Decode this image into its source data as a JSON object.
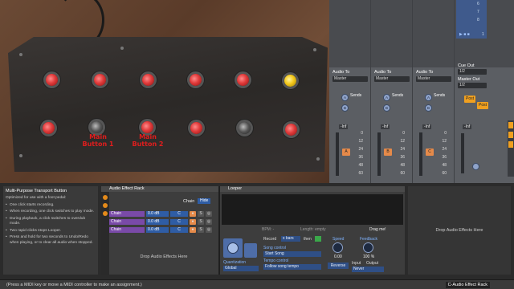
{
  "photo": {
    "labels": [
      "Main\nButton 1",
      "Main\nButton 2"
    ],
    "label_line1": [
      "Main",
      "Main"
    ],
    "label_line2": [
      "Button 1",
      "Button 2"
    ]
  },
  "mixer": {
    "clip_numbers": [
      "6",
      "7",
      "8",
      "1"
    ],
    "tracks": [
      {
        "audio_to": "Audio To",
        "dest": "Master",
        "sends": "Sends",
        "knob_a": "A",
        "knob_b": "B",
        "vol": "-Inf",
        "track_btn": "A",
        "btn_color": "#e58a4a"
      },
      {
        "audio_to": "Audio To",
        "dest": "Master",
        "sends": "Sends",
        "knob_a": "A",
        "knob_b": "B",
        "vol": "-Inf",
        "track_btn": "B",
        "btn_color": "#e58a4a"
      },
      {
        "audio_to": "Audio To",
        "dest": "Master",
        "sends": "Sends",
        "knob_a": "A",
        "knob_b": "B",
        "vol": "-Inf",
        "track_btn": "C",
        "btn_color": "#e58a4a"
      }
    ],
    "cue_out_label": "Cue Out",
    "cue_out_value": "1/2",
    "master_out_label": "Master Out",
    "master_out_value": "1/2",
    "post_labels": [
      "Post",
      "Post"
    ],
    "master_vol": "-Inf",
    "scale": [
      "0",
      "12",
      "24",
      "36",
      "48",
      "60"
    ]
  },
  "info": {
    "title": "Multi-Purpose Transport Button",
    "intro": "Optimized for use with a foot pedal:",
    "bullets": [
      "One click starts recording.",
      "When recording, one click switches to play mode.",
      "During playback, a click switches to overdub mode.",
      "Two rapid clicks stops Looper.",
      "Press and hold for two seconds to Undo/Redo when playing, or to clear all audio when stopped."
    ]
  },
  "rack": {
    "title": "Audio Effect Rack",
    "chain_label": "Chain",
    "hide_label": "Hide",
    "chains": [
      {
        "name": "Chain",
        "db": "0.0 dB",
        "c": "C",
        "s": "S"
      },
      {
        "name": "Chain",
        "db": "0.0 dB",
        "c": "C",
        "s": "S"
      },
      {
        "name": "Chain",
        "db": "0.0 dB",
        "c": "C",
        "s": "S"
      }
    ],
    "drop_text": "Drop Audio Effects Here"
  },
  "looper": {
    "title": "Looper",
    "bpm_label": "BPM: -",
    "length_label": "Length: empty",
    "drag_label": "Drag me!",
    "record_label": "Record",
    "record_value": "x bars",
    "then_label": "then",
    "quantization_label": "Quantization",
    "quantization_value": "Global",
    "song_control_label": "Song control",
    "song_control_value": "Start Song",
    "tempo_control_label": "Tempo control",
    "tempo_control_value": "Follow song tempo",
    "speed_label": "Speed",
    "speed_value": "0.00",
    "reverse_label": "Reverse",
    "feedback_label": "Feedback",
    "feedback_value": "100 %",
    "input_label": "Input",
    "output_label": "Output",
    "input_value": "Never"
  },
  "drop_right": "Drop Audio Effects Here",
  "status": {
    "text": "(Press a MIDI key or move a MIDI controller to make an assignment.)",
    "track": "C-Audio Effect Rack"
  }
}
